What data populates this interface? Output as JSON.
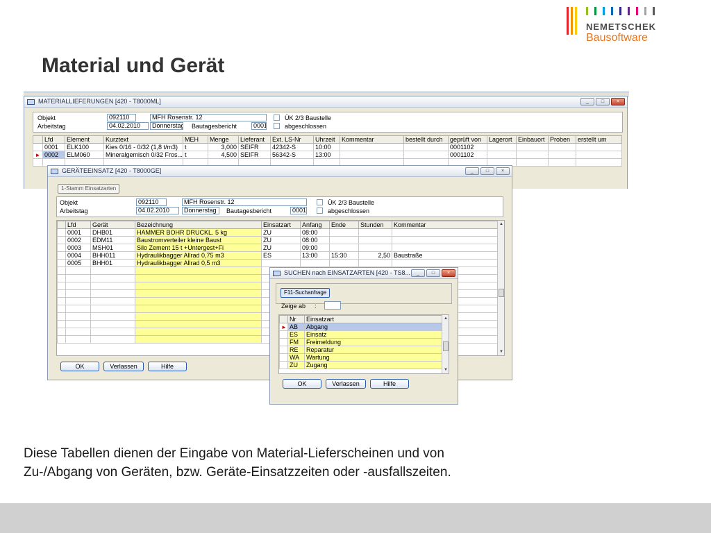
{
  "slide": {
    "title": "Material und Gerät",
    "caption_lines": [
      "Diese Tabellen dienen der Eingabe von Material-Lieferscheinen und von",
      "Zu-/Abgang von Geräten, bzw. Geräte-Einsatzzeiten oder -ausfallszeiten."
    ]
  },
  "logo": {
    "company": "NEMETSCHEK",
    "product": "Bausoftware",
    "bar_colors": [
      "#e4262a",
      "#f39200",
      "#ffcc00",
      "#95c11f",
      "#00963f",
      "#009fe3",
      "#0069b4",
      "#312783",
      "#662483",
      "#e6007e",
      "#a2a2a2",
      "#5a5a5a"
    ]
  },
  "material_window": {
    "title": "MATERIALLIEFERUNGEN  [420 - T8000ML]",
    "header": {
      "objekt_label": "Objekt",
      "objekt_nr": "092110",
      "objekt_name": "MFH Rosenstr. 12",
      "arbeitstag_label": "Arbeitstag",
      "datum": "04.02.2010",
      "wochentag": "Donnerstag",
      "bautagesbericht_label": "Bautagesbericht",
      "bautagesbericht_nr": "0001",
      "chk1_label": "ÜK 2/3 Baustelle",
      "chk2_label": "abgeschlossen"
    },
    "columns": [
      "Lfd",
      "Element",
      "Kurztext",
      "MEH",
      "Menge",
      "Lieferant",
      "Ext. LS-Nr",
      "Uhrzeit",
      "Kommentar",
      "bestellt durch",
      "geprüft von",
      "Lagerort",
      "Einbauort",
      "Proben",
      "erstellt um"
    ],
    "rows": [
      [
        "0001",
        "ELK100",
        "Kies 0/16 - 0/32 (1,8 t/m3)",
        "t",
        "3,000",
        "SEIFR",
        "42342-S",
        "10:00",
        "",
        "",
        "0001102",
        "",
        "",
        "",
        ""
      ],
      [
        "0002",
        "ELM060",
        "Mineralgemisch 0/32 Fros...",
        "t",
        "4,500",
        "SEIFR",
        "56342-S",
        "13:00",
        "",
        "",
        "0001102",
        "",
        "",
        "",
        ""
      ]
    ]
  },
  "geraete_window": {
    "title": "GERÄTEEINSATZ  [420 - T8000GE]",
    "tab_label": "1-Stamm Einsatzarten",
    "header": {
      "objekt_label": "Objekt",
      "objekt_nr": "092110",
      "objekt_name": "MFH Rosenstr. 12",
      "arbeitstag_label": "Arbeitstag",
      "datum": "04.02.2010",
      "wochentag": "Donnerstag",
      "bautagesbericht_label": "Bautagesbericht",
      "bautagesbericht_nr": "0001",
      "chk1_label": "ÜK 2/3 Baustelle",
      "chk2_label": "abgeschlossen"
    },
    "columns": [
      "Lfd",
      "Gerät",
      "Bezeichnung",
      "Einsatzart",
      "Anfang",
      "Ende",
      "Stunden",
      "Kommentar"
    ],
    "rows": [
      [
        "0001",
        "DHB01",
        "HAMMER BOHR DRUCKL. 5 kg",
        "ZU",
        "08:00",
        "",
        "",
        ""
      ],
      [
        "0002",
        "EDM11",
        "Baustromverteiler kleine Baust",
        "ZU",
        "08:00",
        "",
        "",
        ""
      ],
      [
        "0003",
        "MSH01",
        "Silo Zement 15 t +Untergest+Fi",
        "ZU",
        "09:00",
        "",
        "",
        ""
      ],
      [
        "0004",
        "BHH011",
        "Hydraulikbagger Allrad 0,75 m3",
        "ES",
        "13:00",
        "15:30",
        "2,50",
        "Baustraße"
      ],
      [
        "0005",
        "BHH01",
        "Hydraulikbagger Allrad 0,5 m3",
        "",
        "",
        "",
        "",
        ""
      ]
    ],
    "buttons": {
      "ok": "OK",
      "verlassen": "Verlassen",
      "hilfe": "Hilfe"
    }
  },
  "suchen_window": {
    "title": "SUCHEN nach EINSATZARTEN  [420 - TS8...",
    "tab_label": "F11-Suchanfrage",
    "zeige_ab_label": "Zeige ab",
    "zeige_ab_sep": ":",
    "zeige_ab_value": "",
    "columns": [
      "Nr",
      "Einsatzart"
    ],
    "rows": [
      [
        "AB",
        "Abgang"
      ],
      [
        "ES",
        "Einsatz"
      ],
      [
        "FM",
        "Freimeldung"
      ],
      [
        "RE",
        "Reparatur"
      ],
      [
        "WA",
        "Wartung"
      ],
      [
        "ZU",
        "Zugang"
      ]
    ],
    "buttons": {
      "ok": "OK",
      "verlassen": "Verlassen",
      "hilfe": "Hilfe"
    }
  }
}
